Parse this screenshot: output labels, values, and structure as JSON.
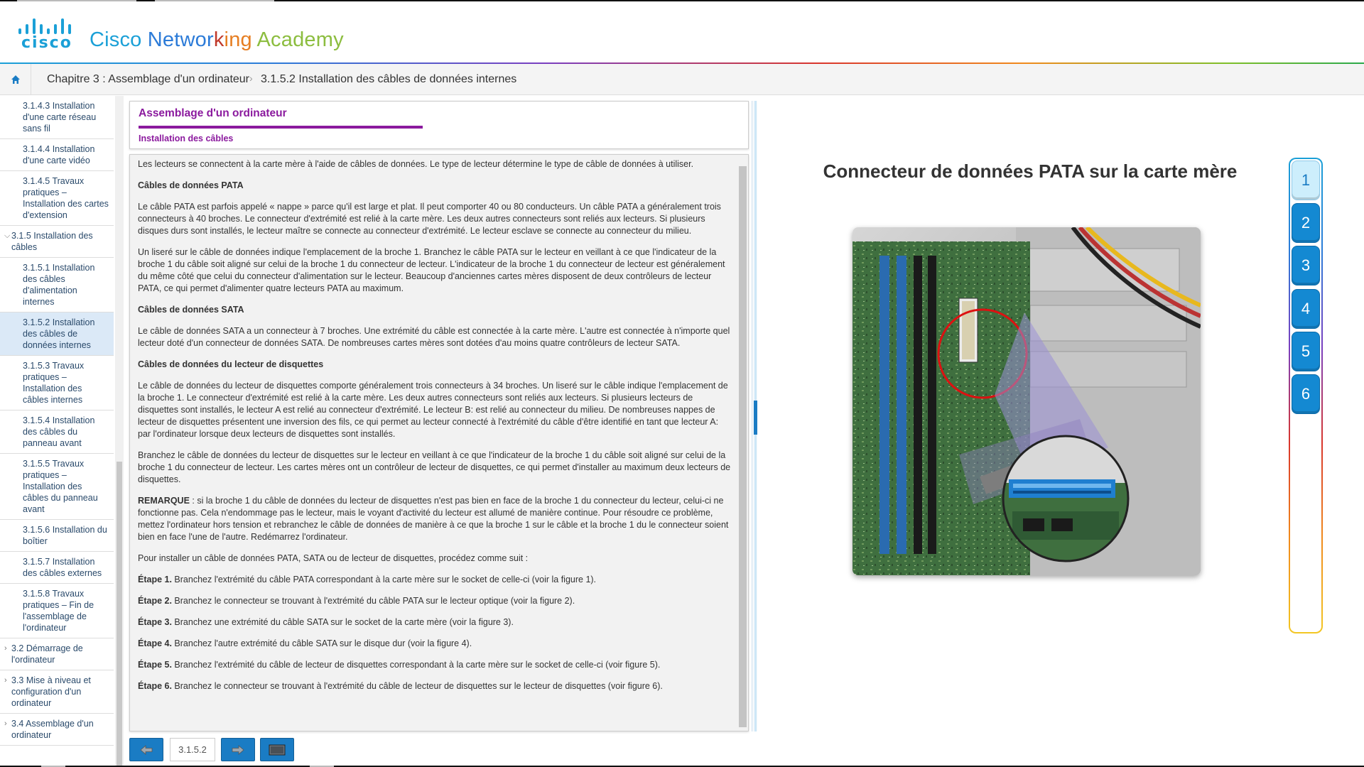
{
  "brand": {
    "logo_word": "cisco",
    "academy": [
      "Cisco ",
      "Networ",
      "k",
      "ing ",
      "Academy"
    ],
    "academy_colors": [
      "#1ba0d7",
      "#2c7bd8",
      "#c0392b",
      "#e67e22",
      "#8cbd3f"
    ]
  },
  "breadcrumb": {
    "home_icon": "home-icon",
    "chapter": "Chapitre 3 : Assemblage d'un ordinateur",
    "separator": "›",
    "current": "3.1.5.2 Installation des câbles de données internes"
  },
  "sidebar": {
    "items": [
      {
        "label": "3.1.4.3 Installation d'une carte réseau sans fil",
        "level": 3
      },
      {
        "label": "3.1.4.4 Installation d'une carte vidéo",
        "level": 3
      },
      {
        "label": "3.1.4.5 Travaux pratiques – Installation des cartes d'extension",
        "level": 3
      },
      {
        "label": "3.1.5 Installation des câbles",
        "level": 2,
        "expanded": true
      },
      {
        "label": "3.1.5.1 Installation des câbles d'alimentation internes",
        "level": 3
      },
      {
        "label": "3.1.5.2 Installation des câbles de données internes",
        "level": 3,
        "active": true
      },
      {
        "label": "3.1.5.3 Travaux pratiques – Installation des câbles internes",
        "level": 3
      },
      {
        "label": "3.1.5.4 Installation des câbles du panneau avant",
        "level": 3
      },
      {
        "label": "3.1.5.5 Travaux pratiques – Installation des câbles du panneau avant",
        "level": 3
      },
      {
        "label": "3.1.5.6 Installation du boîtier",
        "level": 3
      },
      {
        "label": "3.1.5.7 Installation des câbles externes",
        "level": 3
      },
      {
        "label": "3.1.5.8 Travaux pratiques – Fin de l'assemblage de l'ordinateur",
        "level": 3
      },
      {
        "label": "3.2 Démarrage de l'ordinateur",
        "level": 2
      },
      {
        "label": "3.3 Mise à niveau et configuration d'un ordinateur",
        "level": 2
      },
      {
        "label": "3.4 Assemblage d'un ordinateur",
        "level": 2
      }
    ]
  },
  "content": {
    "title": "Assemblage d'un ordinateur",
    "subtitle": "Installation des câbles",
    "intro": "Les lecteurs se connectent à la carte mère à l'aide de câbles de données. Le type de lecteur détermine le type de câble de données à utiliser.",
    "pata_heading": "Câbles de données PATA",
    "pata_p1": "Le câble PATA est parfois appelé « nappe » parce qu'il est large et plat. Il peut comporter 40 ou 80 conducteurs. Un câble PATA a généralement trois connecteurs à 40 broches. Le connecteur d'extrémité est relié à la carte mère. Les deux autres connecteurs sont reliés aux lecteurs. Si plusieurs disques durs sont installés, le lecteur maître se connecte au connecteur d'extrémité. Le lecteur esclave se connecte au connecteur du milieu.",
    "pata_p2": "Un liseré sur le câble de données indique l'emplacement de la broche 1. Branchez le câble PATA sur le lecteur en veillant à ce que l'indicateur de la broche 1 du câble soit aligné sur celui de la broche 1 du connecteur de lecteur. L'indicateur de la broche 1 du connecteur de lecteur est généralement du même côté que celui du connecteur d'alimentation sur le lecteur. Beaucoup d'anciennes cartes mères disposent de deux contrôleurs de lecteur PATA, ce qui permet d'alimenter quatre lecteurs PATA au maximum.",
    "sata_heading": "Câbles de données SATA",
    "sata_p1": "Le câble de données SATA a un connecteur à 7 broches. Une extrémité du câble est connectée à la carte mère. L'autre est connectée à n'importe quel lecteur doté d'un connecteur de données SATA. De nombreuses cartes mères sont dotées d'au moins quatre contrôleurs de lecteur SATA.",
    "floppy_heading": "Câbles de données du lecteur de disquettes",
    "floppy_p1": "Le câble de données du lecteur de disquettes comporte généralement trois connecteurs à 34 broches. Un liseré sur le câble indique l'emplacement de la broche 1. Le connecteur d'extrémité est relié à la carte mère. Les deux autres connecteurs sont reliés aux lecteurs. Si plusieurs lecteurs de disquettes sont installés, le lecteur A est relié au connecteur d'extrémité. Le lecteur B: est relié au connecteur du milieu. De nombreuses nappes de lecteur de disquettes présentent une inversion des fils, ce qui permet au lecteur connecté à l'extrémité du câble d'être identifié en tant que lecteur A: par l'ordinateur lorsque deux lecteurs de disquettes sont installés.",
    "floppy_p2": "Branchez le câble de données du lecteur de disquettes sur le lecteur en veillant à ce que l'indicateur de la broche 1 du câble soit aligné sur celui de la broche 1 du connecteur de lecteur. Les cartes mères ont un contrôleur de lecteur de disquettes, ce qui permet d'installer au maximum deux lecteurs de disquettes.",
    "note_label": "REMARQUE",
    "note_text": " : si la broche 1 du câble de données du lecteur de disquettes n'est pas bien en face de la broche 1 du connecteur du lecteur, celui-ci ne fonctionne pas. Cela n'endommage pas le lecteur, mais le voyant d'activité du lecteur est allumé de manière continue. Pour résoudre ce problème, mettez l'ordinateur hors tension et rebranchez le câble de données de manière à ce que la broche 1 sur le câble et la broche 1 du le connecteur soient bien en face l'une de l'autre. Redémarrez l'ordinateur.",
    "steps_intro": "Pour installer un câble de données PATA, SATA ou de lecteur de disquettes, procédez comme suit :",
    "steps": [
      {
        "label": "Étape 1.",
        "text": " Branchez l'extrémité du câble PATA correspondant à la carte mère sur le socket de celle-ci (voir la figure 1)."
      },
      {
        "label": "Étape 2.",
        "text": " Branchez le connecteur se trouvant à l'extrémité du câble PATA sur le lecteur optique (voir la figure 2)."
      },
      {
        "label": "Étape 3.",
        "text": " Branchez une extrémité du câble SATA sur le socket de la carte mère (voir la figure 3)."
      },
      {
        "label": "Étape 4.",
        "text": " Branchez l'autre extrémité du câble SATA sur le disque dur (voir la figure 4)."
      },
      {
        "label": "Étape 5.",
        "text": " Branchez l'extrémité du câble de lecteur de disquettes correspondant à la carte mère sur le socket de celle-ci (voir figure 5)."
      },
      {
        "label": "Étape 6.",
        "text": " Branchez le connecteur se trouvant à l'extrémité du câble de lecteur de disquettes sur le lecteur de disquettes (voir figure 6)."
      }
    ]
  },
  "bottom_nav": {
    "prev_icon": "arrow-left-icon",
    "page": "3.1.5.2",
    "next_icon": "arrow-right-icon",
    "fullscreen_icon": "screen-icon"
  },
  "figure": {
    "title": "Connecteur de données PATA sur la carte mère",
    "tabs": [
      "1",
      "2",
      "3",
      "4",
      "5",
      "6"
    ],
    "active_tab": "1"
  },
  "colors": {
    "accent_purple": "#8b1a9e",
    "accent_blue": "#1a7cc4",
    "tab_blue": "#1489d2"
  }
}
